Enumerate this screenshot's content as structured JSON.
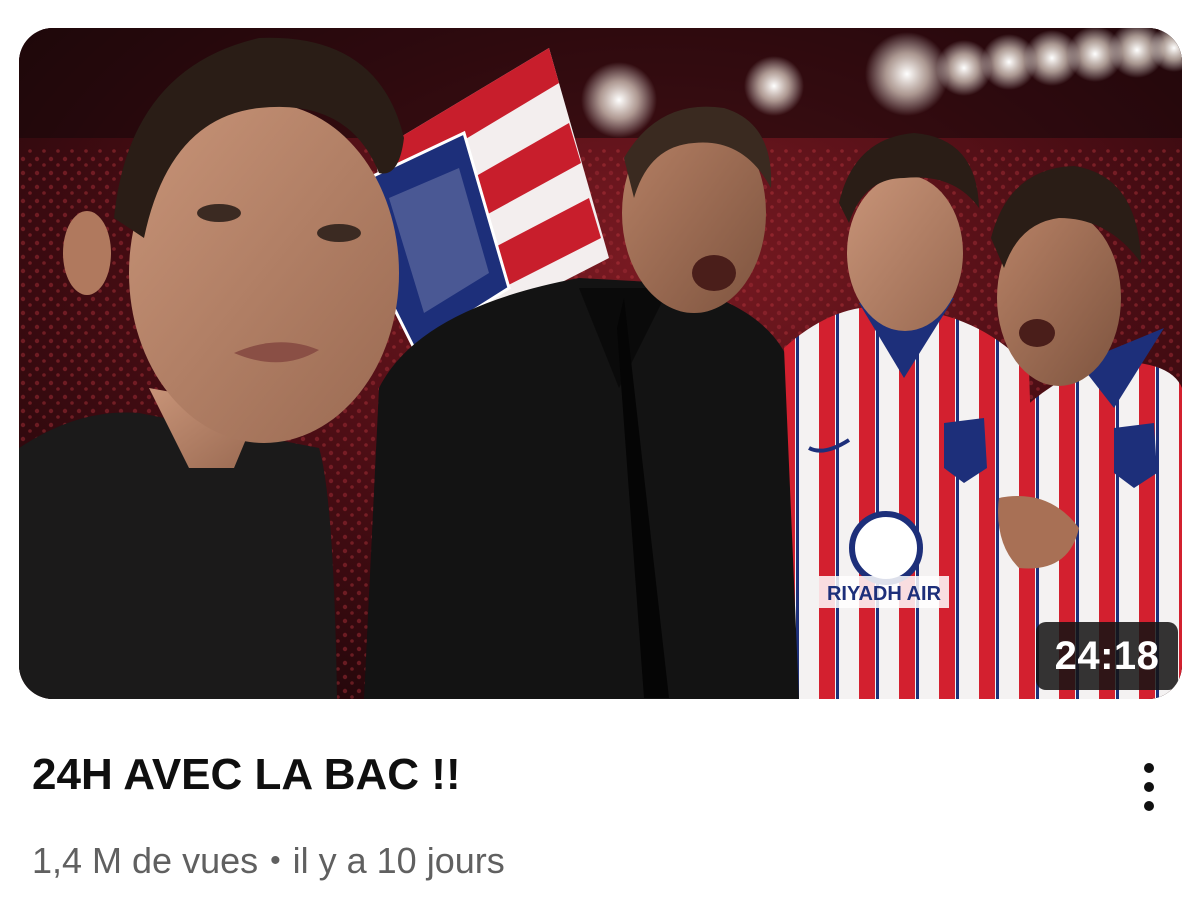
{
  "video": {
    "duration": "24:18",
    "title": "24H AVEC LA BAC !!",
    "views": "1,4 M de vues",
    "separator": "•",
    "age": "il y a 10 jours",
    "jersey_sponsor": "RIYADH AIR",
    "more_icon": "more-vertical-icon"
  },
  "colors": {
    "title_text": "#0f0f0f",
    "meta_text": "#606060",
    "duration_bg": "#141414",
    "atleti_red": "#d3202f",
    "atleti_blue": "#1d2f7a"
  }
}
